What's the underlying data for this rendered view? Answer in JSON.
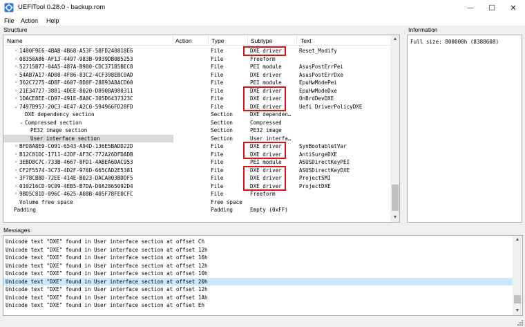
{
  "window": {
    "title": "UEFITool 0.28.0 - backup.rom",
    "minimize_glyph": "—",
    "maximize_glyph": "☐",
    "close_glyph": "✕"
  },
  "menu": [
    "File",
    "Action",
    "Help"
  ],
  "structure": {
    "label": "Structure",
    "columns": {
      "name": "Name",
      "action": "Action",
      "type": "Type",
      "subtype": "Subtype",
      "text": "Text"
    },
    "rows": [
      {
        "expander": "›",
        "indent": 1,
        "name": "1400F9E6-4BAB-4B68-A53F-58FD240818E6",
        "type": "File",
        "subtype": "DXE driver",
        "text": "Reset_Modify",
        "highlighted": true
      },
      {
        "expander": "›",
        "indent": 1,
        "name": "08350A86-AF13-4497-983B-9939DB0B5253",
        "type": "File",
        "subtype": "Freeform",
        "text": ""
      },
      {
        "expander": "›",
        "indent": 1,
        "name": "52715B77-04A5-487A-B980-CDC371B5BEC8",
        "type": "File",
        "subtype": "PEI module",
        "text": "AsusPostErrPei"
      },
      {
        "expander": "›",
        "indent": 1,
        "name": "54AB7A17-AD08-4F86-83C2-4CF398EBC0AD",
        "type": "File",
        "subtype": "DXE driver",
        "text": "AsusPostErrDxe"
      },
      {
        "expander": "›",
        "indent": 1,
        "name": "362C7275-4D8F-4607-8D8F-28893A8ACD60",
        "type": "File",
        "subtype": "PEI module",
        "text": "EpuHwModePei"
      },
      {
        "expander": "›",
        "indent": 1,
        "name": "21E34727-3881-4DEE-8020-D8908A980311",
        "type": "File",
        "subtype": "DXE driver",
        "text": "EpuHwModeDxe",
        "highlighted": true
      },
      {
        "expander": "›",
        "indent": 1,
        "name": "1DACE8EE-CD97-491E-8A0C-305D6437323C",
        "type": "File",
        "subtype": "DXE driver",
        "text": "OnBrdDevDXE",
        "highlighted": true
      },
      {
        "expander": "⌄",
        "indent": 1,
        "name": "7497B957-20C3-4E47-A2C0-594966FD28FD",
        "type": "File",
        "subtype": "DXE driver",
        "text": "Uefi DriverPolicyDXE",
        "highlighted": true
      },
      {
        "expander": "",
        "indent": 2,
        "name": "DXE dependency section",
        "type": "Section",
        "subtype": "DXE dependen…",
        "text": ""
      },
      {
        "expander": "⌄",
        "indent": 2,
        "name": "Compressed section",
        "type": "Section",
        "subtype": "Compressed",
        "text": ""
      },
      {
        "expander": "",
        "indent": 3,
        "name": "PE32 image section",
        "type": "Section",
        "subtype": "PE32 image",
        "text": ""
      },
      {
        "expander": "",
        "indent": 3,
        "name": "User interface section",
        "type": "Section",
        "subtype": "User interfa…",
        "text": "",
        "selected": true
      },
      {
        "expander": "›",
        "indent": 1,
        "name": "BFD8A8E9-C091-6543-A94D-136E5BADD22D",
        "type": "File",
        "subtype": "DXE driver",
        "text": "SynBootabletVar",
        "highlighted": true
      },
      {
        "expander": "›",
        "indent": 1,
        "name": "B12C81DC-1711-42DF-AF3C-772A26DFDADB",
        "type": "File",
        "subtype": "DXE driver",
        "text": "AntiSurgeDXE",
        "highlighted": true
      },
      {
        "expander": "›",
        "indent": 1,
        "name": "3EBD8C7C-733B-4667-8FD1-4ABEA6DAC953",
        "type": "File",
        "subtype": "PEI module",
        "text": "ASUSDirectKeyPEI"
      },
      {
        "expander": "›",
        "indent": 1,
        "name": "CF2F5574-3C73-4D2F-976D-665CAD2E5381",
        "type": "File",
        "subtype": "DXE driver",
        "text": "ASUSDirectKeyDXE",
        "highlighted": true
      },
      {
        "expander": "›",
        "indent": 1,
        "name": "3F78CB8D-72EE-414E-B023-DACA003BDDF5",
        "type": "File",
        "subtype": "DXE driver",
        "text": "ProjectSMI",
        "highlighted": true
      },
      {
        "expander": "›",
        "indent": 1,
        "name": "010216CD-9C09-4EB5-B7DA-D0A2865092D4",
        "type": "File",
        "subtype": "DXE driver",
        "text": "ProjectDXE",
        "highlighted": true
      },
      {
        "expander": "›",
        "indent": 1,
        "name": "9BD5C81D-096C-4625-A08B-405F78FE0CFC",
        "type": "File",
        "subtype": "Freeform",
        "text": ""
      },
      {
        "expander": "",
        "indent": 1,
        "name": "Volume free space",
        "type": "Free space",
        "subtype": "",
        "text": ""
      },
      {
        "expander": "",
        "indent": 0,
        "name": "Padding",
        "type": "Padding",
        "subtype": "Empty (0xFF)",
        "text": ""
      }
    ],
    "scroll_up_glyph": "▲",
    "scroll_down_glyph": "▼"
  },
  "information": {
    "label": "Information",
    "text": "Full size: 800000h (8388608)"
  },
  "messages": {
    "label": "Messages",
    "items": [
      {
        "text": "Unicode text \"DXE\" found in User interface section at offset Ch"
      },
      {
        "text": "Unicode text \"DXE\" found in User interface section at offset 12h"
      },
      {
        "text": "Unicode text \"DXE\" found in User interface section at offset 16h"
      },
      {
        "text": "Unicode text \"DXE\" found in User interface section at offset 12h"
      },
      {
        "text": "Unicode text \"DXE\" found in User interface section at offset 10h"
      },
      {
        "text": "Unicode text \"DXE\" found in User interface section at offset 20h",
        "selected": true
      },
      {
        "text": "Unicode text \"DXE\" found in User interface section at offset 12h"
      },
      {
        "text": "Unicode text \"DXE\" found in User interface section at offset 1Ah"
      },
      {
        "text": "Unicode text \"DXE\" found in User interface section at offset Eh"
      }
    ]
  },
  "colors": {
    "highlight_box": "#e0101a",
    "selected_tree_row": "#d9d9d9",
    "selected_message": "#cce8ff"
  }
}
